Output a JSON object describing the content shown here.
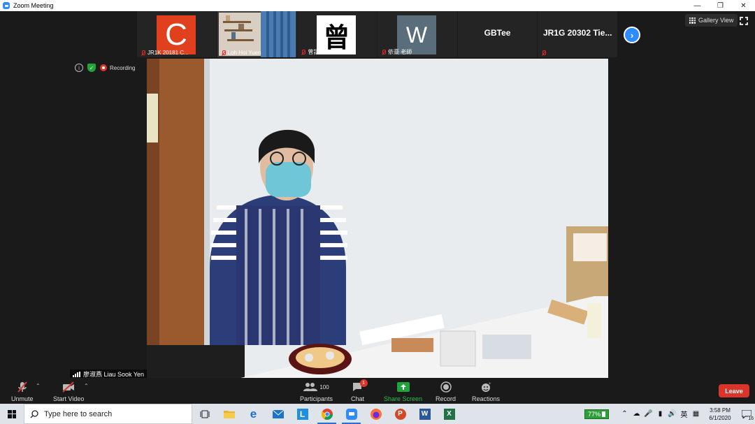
{
  "window": {
    "title": "Zoom Meeting"
  },
  "gallery": {
    "tiles": [
      {
        "type": "avatar-letter",
        "letter": "C",
        "color": "#e0401e",
        "name": "JR1K 20181 C..."
      },
      {
        "type": "photo",
        "name": "Loh Hoi Yuen"
      },
      {
        "type": "avatar-glyph",
        "glyph": "曾",
        "name": "曾語彤"
      },
      {
        "type": "avatar-letter",
        "letter": "W",
        "color": "#5a6d7a",
        "name": "依豪 老師"
      },
      {
        "type": "text",
        "bigname": "GBTee"
      },
      {
        "type": "text-muted",
        "bigname": "JR1G 20302 Tie..."
      }
    ],
    "view_label": "Gallery View"
  },
  "status": {
    "recording_label": "Recording"
  },
  "speaker": {
    "name": "廖淑燕 Liau Sook Yen"
  },
  "toolbar": {
    "unmute": "Unmute",
    "start_video": "Start Video",
    "participants": "Participants",
    "participants_count": "100",
    "chat": "Chat",
    "chat_badge": "1",
    "share_screen": "Share Screen",
    "record": "Record",
    "reactions": "Reactions",
    "leave": "Leave"
  },
  "taskbar": {
    "search_placeholder": "Type here to search",
    "battery": "77%",
    "ime_lang": "英",
    "time": "3:58 PM",
    "date": "6/1/2020",
    "notifications": "16"
  },
  "colors": {
    "accent": "#2d8cff",
    "leave": "#d9352b",
    "share": "#1fa43b"
  }
}
